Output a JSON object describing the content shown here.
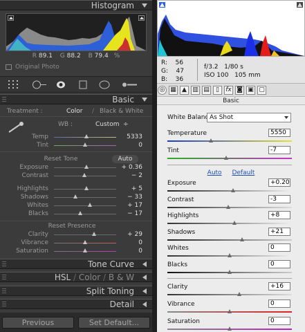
{
  "lightroom": {
    "histogram_title": "Histogram",
    "rgb": {
      "r_label": "R",
      "r": "89.1",
      "g_label": "G",
      "g": "88.2",
      "b_label": "B",
      "b": "79.4",
      "unit": "%"
    },
    "original_photo": "Original Photo",
    "basic_title": "Basic",
    "treatment_label": "Treatment :",
    "treatment_color": "Color",
    "treatment_divider": "/",
    "treatment_bw": "Black & White",
    "wb_label": "WB :",
    "wb_value": "Custom",
    "wb_arrows": "÷",
    "sliders_wb": [
      {
        "label": "Temp",
        "value": "5333",
        "pos": 0.52
      },
      {
        "label": "Tint",
        "value": "0",
        "pos": 0.5
      }
    ],
    "reset_tone": "Reset Tone",
    "auto": "Auto",
    "sliders_tone": [
      {
        "label": "Exposure",
        "value": "+ 0.36",
        "pos": 0.52
      },
      {
        "label": "Contrast",
        "value": "− 2",
        "pos": 0.49
      }
    ],
    "sliders_tone2": [
      {
        "label": "Highlights",
        "value": "+ 5",
        "pos": 0.52
      },
      {
        "label": "Shadows",
        "value": "− 33",
        "pos": 0.34
      },
      {
        "label": "Whites",
        "value": "+ 17",
        "pos": 0.58
      },
      {
        "label": "Blacks",
        "value": "− 17",
        "pos": 0.42
      }
    ],
    "reset_presence": "Reset Presence",
    "sliders_presence": [
      {
        "label": "Clarity",
        "value": "+ 29",
        "pos": 0.64
      },
      {
        "label": "Vibrance",
        "value": "0",
        "pos": 0.5
      },
      {
        "label": "Saturation",
        "value": "0",
        "pos": 0.5
      }
    ],
    "panels": [
      "Tone Curve",
      "Split Toning",
      "Detail"
    ],
    "hsl": {
      "h": "HSL",
      "c": "Color",
      "b": "B & W",
      "slash": "/"
    },
    "previous": "Previous",
    "set_default": "Set Default..."
  },
  "camera_raw": {
    "r_label": "R:",
    "r": "56",
    "g_label": "G:",
    "g": "47",
    "b_label": "B:",
    "b": "36",
    "aperture": "f/3.2",
    "shutter": "1/80 s",
    "iso": "ISO 100",
    "focal": "105 mm",
    "basic_title": "Basic",
    "wb_label": "White Balance:",
    "wb_value": "As Shot",
    "auto": "Auto",
    "default": "Default",
    "rows_top": [
      {
        "label": "Temperature",
        "value": "5550",
        "pos": 0.35
      },
      {
        "label": "Tint",
        "value": "-7",
        "pos": 0.47
      }
    ],
    "rows_tone": [
      {
        "label": "Exposure",
        "value": "+0.20",
        "pos": 0.53
      },
      {
        "label": "Contrast",
        "value": "-3",
        "pos": 0.49
      },
      {
        "label": "Highlights",
        "value": "+8",
        "pos": 0.54
      },
      {
        "label": "Shadows",
        "value": "+21",
        "pos": 0.6
      },
      {
        "label": "Whites",
        "value": "0",
        "pos": 0.5
      },
      {
        "label": "Blacks",
        "value": "0",
        "pos": 0.5
      }
    ],
    "rows_presence": [
      {
        "label": "Clarity",
        "value": "+16",
        "pos": 0.58
      },
      {
        "label": "Vibrance",
        "value": "0",
        "pos": 0.5
      },
      {
        "label": "Saturation",
        "value": "0",
        "pos": 0.5
      }
    ],
    "icon_fx": "fx"
  },
  "colors": {
    "lr_bg": "#3b3b3b",
    "acr_bg": "#ececec",
    "link": "#1d4fb8"
  }
}
